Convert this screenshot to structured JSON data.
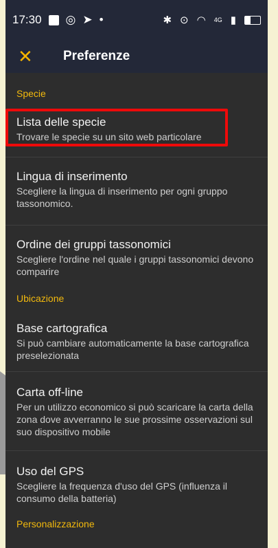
{
  "status_bar": {
    "time": "17:30",
    "network": "4G"
  },
  "toolbar": {
    "title": "Preferenze"
  },
  "sections": [
    {
      "header": "Specie",
      "items": [
        {
          "title": "Lista delle specie",
          "subtitle": "Trovare le specie su un sito web particolare"
        },
        {
          "title": "Lingua di inserimento",
          "subtitle": "Scegliere la lingua di inserimento per ogni gruppo tassonomico."
        },
        {
          "title": "Ordine dei gruppi tassonomici",
          "subtitle": "Scegliere l'ordine nel quale i gruppi tassonomici devono comparire"
        }
      ]
    },
    {
      "header": "Ubicazione",
      "items": [
        {
          "title": "Base cartografica",
          "subtitle": "Si può cambiare automaticamente la base cartografica preselezionata"
        },
        {
          "title": "Carta off-line",
          "subtitle": "Per un utilizzo economico si può scaricare la carta della zona dove avverranno le sue prossime osservazioni sul suo dispositivo mobile"
        },
        {
          "title": "Uso del GPS",
          "subtitle": "Scegliere la frequenza d'uso del GPS (influenza il consumo della batteria)"
        }
      ]
    },
    {
      "header": "Personalizzazione",
      "items": []
    }
  ],
  "colors": {
    "accent": "#f2b90d",
    "highlight": "#ee0a0a",
    "toolbar": "#232838",
    "background": "#2d2d2d"
  }
}
